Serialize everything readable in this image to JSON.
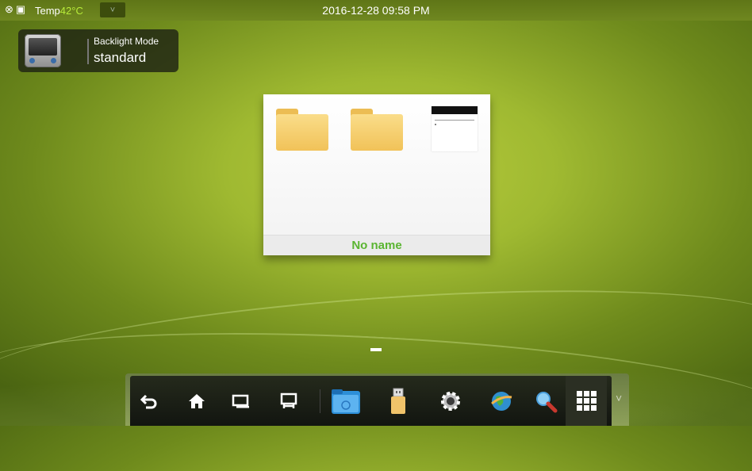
{
  "status_bar": {
    "temp_label": "Temp",
    "temp_value": "42°C",
    "datetime": "2016-12-28 09:58 PM",
    "dropdown_glyph": "˅"
  },
  "backlight": {
    "title": "Backlight Mode",
    "value": "standard"
  },
  "file_card": {
    "name": "No name"
  },
  "dock": {
    "items": [
      {
        "name": "back-icon",
        "glyph": "⮌"
      },
      {
        "name": "home-icon",
        "glyph": "⌂"
      },
      {
        "name": "multitask-icon",
        "glyph": ""
      },
      {
        "name": "display-icon",
        "glyph": ""
      },
      {
        "name": "file-manager-icon",
        "glyph": ""
      },
      {
        "name": "usb-icon",
        "glyph": ""
      },
      {
        "name": "settings-icon",
        "glyph": "⚙"
      },
      {
        "name": "browser-icon",
        "glyph": ""
      },
      {
        "name": "search-icon",
        "glyph": ""
      },
      {
        "name": "apps-icon",
        "glyph": ""
      }
    ],
    "expand_glyph": "˅"
  },
  "colors": {
    "accent_green": "#5ab531",
    "temp_green": "#b8ec3a"
  }
}
